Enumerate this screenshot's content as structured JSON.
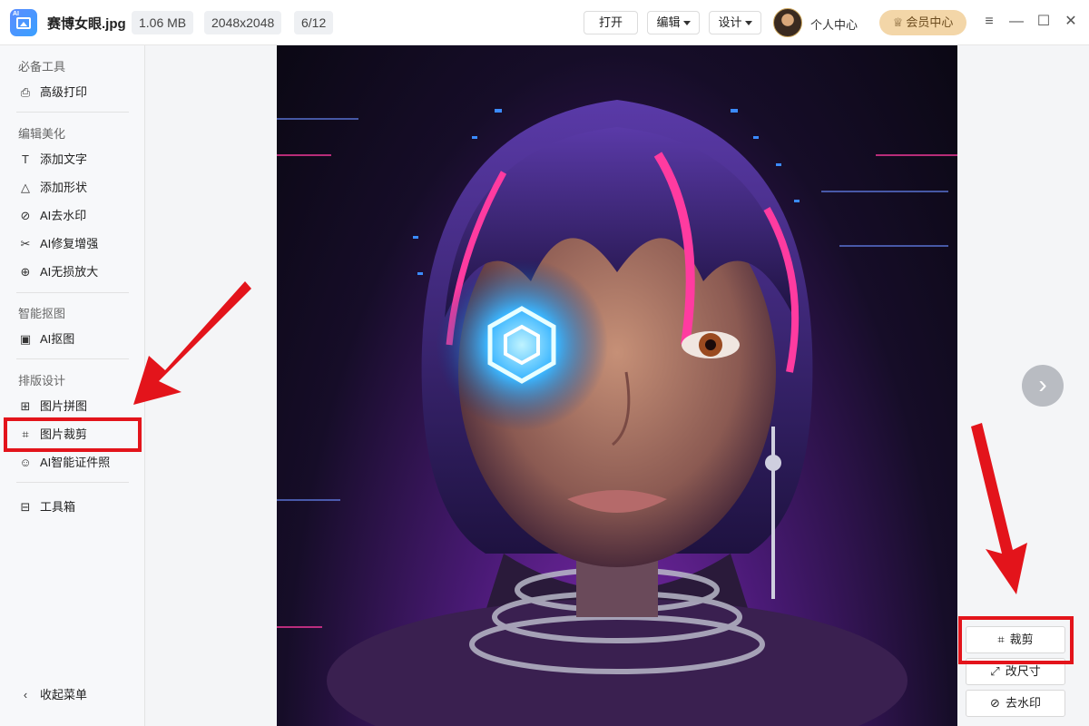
{
  "titlebar": {
    "filename": "赛博女眼.jpg",
    "file_size": "1.06 MB",
    "dimensions": "2048x2048",
    "page_indicator": "6/12",
    "open_label": "打开",
    "edit_label": "编辑",
    "design_label": "设计",
    "user_center_label": "个人中心",
    "vip_label": "会员中心"
  },
  "sidebar": {
    "sections": [
      {
        "title": "必备工具",
        "items": [
          {
            "label": "高级打印",
            "icon": "printer-icon"
          }
        ]
      },
      {
        "title": "编辑美化",
        "items": [
          {
            "label": "添加文字",
            "icon": "text-icon"
          },
          {
            "label": "添加形状",
            "icon": "shapes-icon"
          },
          {
            "label": "AI去水印",
            "icon": "watermark-remove-icon"
          },
          {
            "label": "AI修复增强",
            "icon": "repair-icon"
          },
          {
            "label": "AI无损放大",
            "icon": "zoom-in-icon"
          }
        ]
      },
      {
        "title": "智能抠图",
        "items": [
          {
            "label": "AI抠图",
            "icon": "image-cutout-icon"
          }
        ]
      },
      {
        "title": "排版设计",
        "items": [
          {
            "label": "图片拼图",
            "icon": "collage-icon"
          },
          {
            "label": "图片裁剪",
            "icon": "crop-icon"
          },
          {
            "label": "AI智能证件照",
            "icon": "id-photo-icon"
          }
        ]
      }
    ],
    "toolbox_label": "工具箱",
    "collapse_label": "收起菜单"
  },
  "canvas": {
    "tools": [
      {
        "label": "裁剪",
        "icon": "crop-icon"
      },
      {
        "label": "改尺寸",
        "icon": "resize-icon"
      },
      {
        "label": "去水印",
        "icon": "watermark-remove-icon"
      }
    ]
  },
  "colors": {
    "highlight": "#e3141b",
    "vip_bg": "#f3d6a8",
    "accent": "#3aa0ff"
  }
}
